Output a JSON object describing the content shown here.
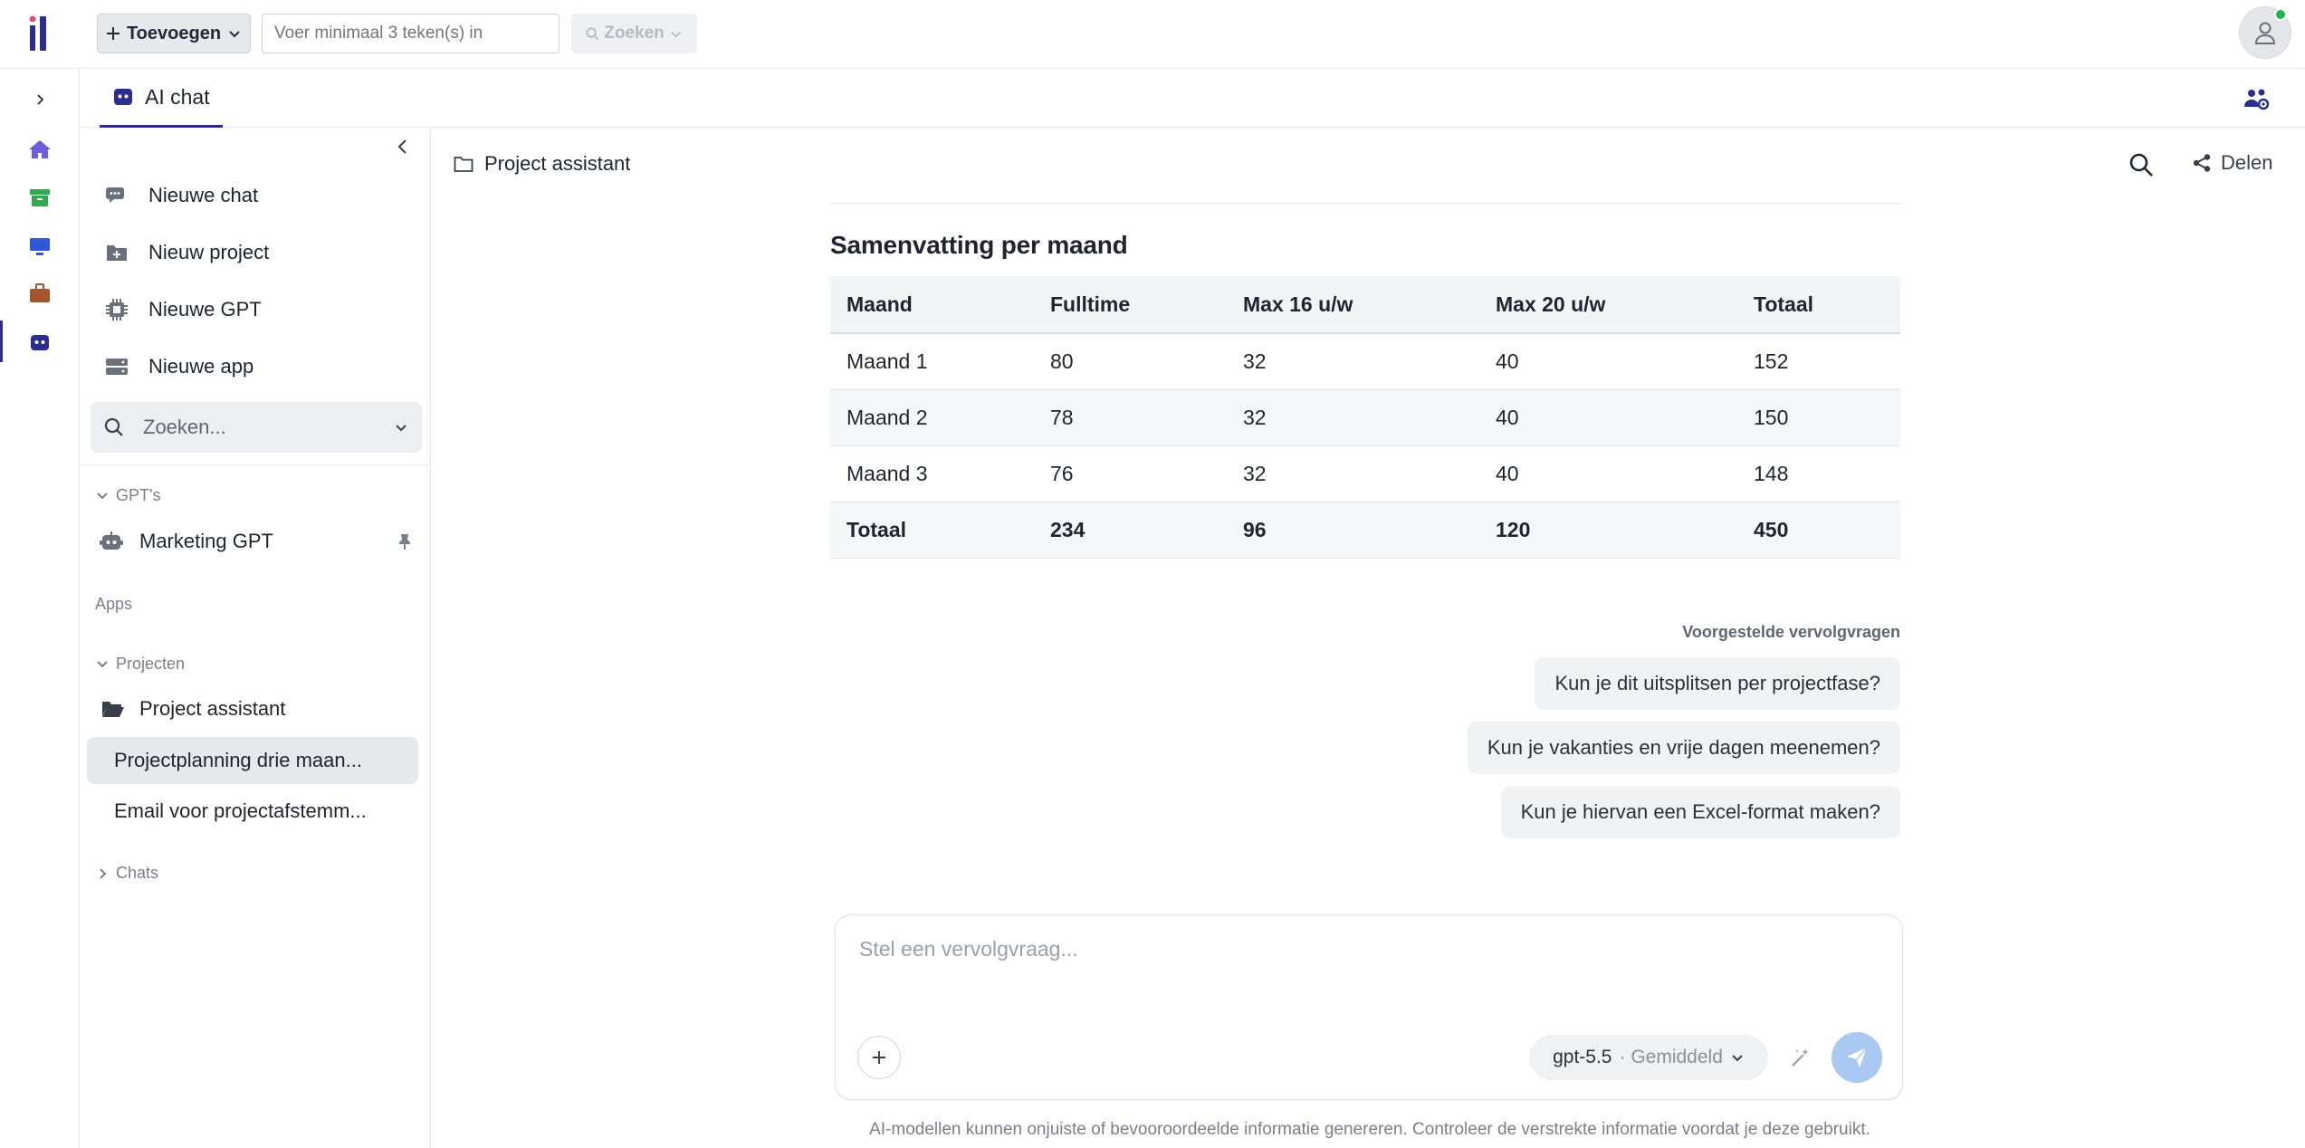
{
  "topbar": {
    "add_label": "Toevoegen",
    "search_placeholder": "Voer minimaal 3 teken(s) in",
    "search_button_label": "Zoeken"
  },
  "tabs": [
    {
      "label": "AI chat",
      "active": true
    }
  ],
  "sidebar": {
    "actions": [
      {
        "label": "Nieuwe chat",
        "icon": "chat-bubbles-icon"
      },
      {
        "label": "Nieuw project",
        "icon": "folder-plus-icon"
      },
      {
        "label": "Nieuwe GPT",
        "icon": "chip-icon"
      },
      {
        "label": "Nieuwe app",
        "icon": "server-icon"
      }
    ],
    "search_placeholder": "Zoeken...",
    "gpts_header": "GPT's",
    "gpts": [
      {
        "label": "Marketing GPT",
        "pinned": true
      }
    ],
    "apps_header": "Apps",
    "projects_header": "Projecten",
    "project": {
      "label": "Project assistant"
    },
    "project_chats": [
      {
        "label": "Projectplanning drie maan...",
        "active": true
      },
      {
        "label": "Email voor projectafstemm...",
        "active": false
      }
    ],
    "chats_header": "Chats"
  },
  "main": {
    "breadcrumb": "Project assistant",
    "share_label": "Delen",
    "summary_title": "Samenvatting per maand",
    "table": {
      "headers": [
        "Maand",
        "Fulltime",
        "Max 16 u/w",
        "Max 20 u/w",
        "Totaal"
      ],
      "rows": [
        [
          "Maand 1",
          "80",
          "32",
          "40",
          "152"
        ],
        [
          "Maand 2",
          "78",
          "32",
          "40",
          "150"
        ],
        [
          "Maand 3",
          "76",
          "32",
          "40",
          "148"
        ],
        [
          "Totaal",
          "234",
          "96",
          "120",
          "450"
        ]
      ]
    },
    "suggestions_label": "Voorgestelde vervolgvragen",
    "suggestions": [
      "Kun je dit uitsplitsen per projectfase?",
      "Kun je vakanties en vrije dagen meenemen?",
      "Kun je hiervan een Excel-format maken?"
    ],
    "composer": {
      "placeholder": "Stel een vervolgvraag...",
      "model": "gpt-5.5",
      "mode": "· Gemiddeld"
    },
    "disclaimer": "AI-modellen kunnen onjuiste of bevooroordeelde informatie genereren. Controleer de verstrekte informatie voordat je deze gebruikt."
  },
  "colors": {
    "accent": "#2b2e8c",
    "active_bg": "#e6e8ec",
    "send_button": "#a9c8f2",
    "online_dot": "#22b14c"
  }
}
